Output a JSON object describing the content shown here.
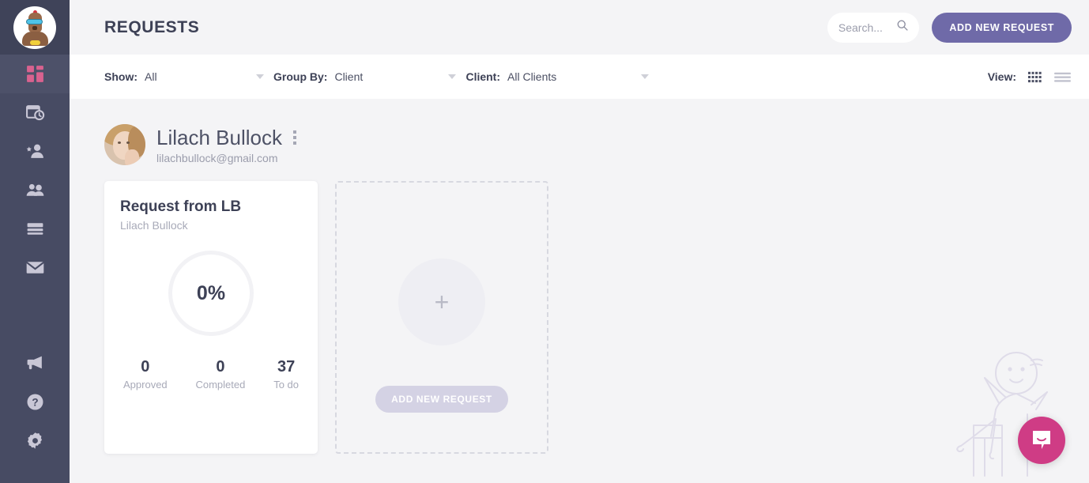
{
  "sidebar": {
    "avatar_icon": "robot-avatar",
    "items": [
      {
        "icon": "dashboard-grid-icon",
        "active": true
      },
      {
        "icon": "calendar-clock-icon",
        "active": false
      },
      {
        "icon": "person-star-icon",
        "active": false
      },
      {
        "icon": "people-icon",
        "active": false
      },
      {
        "icon": "layers-list-icon",
        "active": false
      },
      {
        "icon": "envelope-icon",
        "active": false
      }
    ],
    "bottom_items": [
      {
        "icon": "megaphone-icon"
      },
      {
        "icon": "help-circle-icon"
      },
      {
        "icon": "gear-icon"
      }
    ]
  },
  "header": {
    "title": "REQUESTS",
    "search": {
      "value": "",
      "placeholder": "Search...",
      "icon": "search-icon"
    },
    "add_request_label": "ADD NEW REQUEST"
  },
  "filters": {
    "show": {
      "label": "Show:",
      "value": "All"
    },
    "group_by": {
      "label": "Group By:",
      "value": "Client"
    },
    "client": {
      "label": "Client:",
      "value": "All Clients"
    },
    "view": {
      "label": "View:",
      "grid_icon": "grid-view-icon",
      "list_icon": "list-view-icon",
      "active": "grid"
    }
  },
  "client_group": {
    "name": "Lilach Bullock",
    "email": "lilachbullock@gmail.com",
    "avatar_icon": "client-avatar",
    "menu_icon": "more-vertical-icon"
  },
  "request_card": {
    "title": "Request from LB",
    "subtitle": "Lilach Bullock",
    "progress_value": "0%",
    "stats": [
      {
        "number": "0",
        "label": "Approved"
      },
      {
        "number": "0",
        "label": "Completed"
      },
      {
        "number": "37",
        "label": "To do"
      }
    ]
  },
  "placeholder_card": {
    "plus_icon": "plus-icon",
    "add_request_label": "ADD NEW REQUEST"
  },
  "decoration": {
    "illustration_icon": "person-sitting-illustration",
    "chat_icon": "chat-bubble-icon"
  },
  "colors": {
    "sidebar_bg": "#474b63",
    "accent_purple": "#6f6aa8",
    "accent_pink": "#d9628f",
    "chat_pink": "#cf3c85",
    "page_bg": "#f4f4f6",
    "text_dark": "#3d4156",
    "text_muted": "#a8aab8"
  }
}
